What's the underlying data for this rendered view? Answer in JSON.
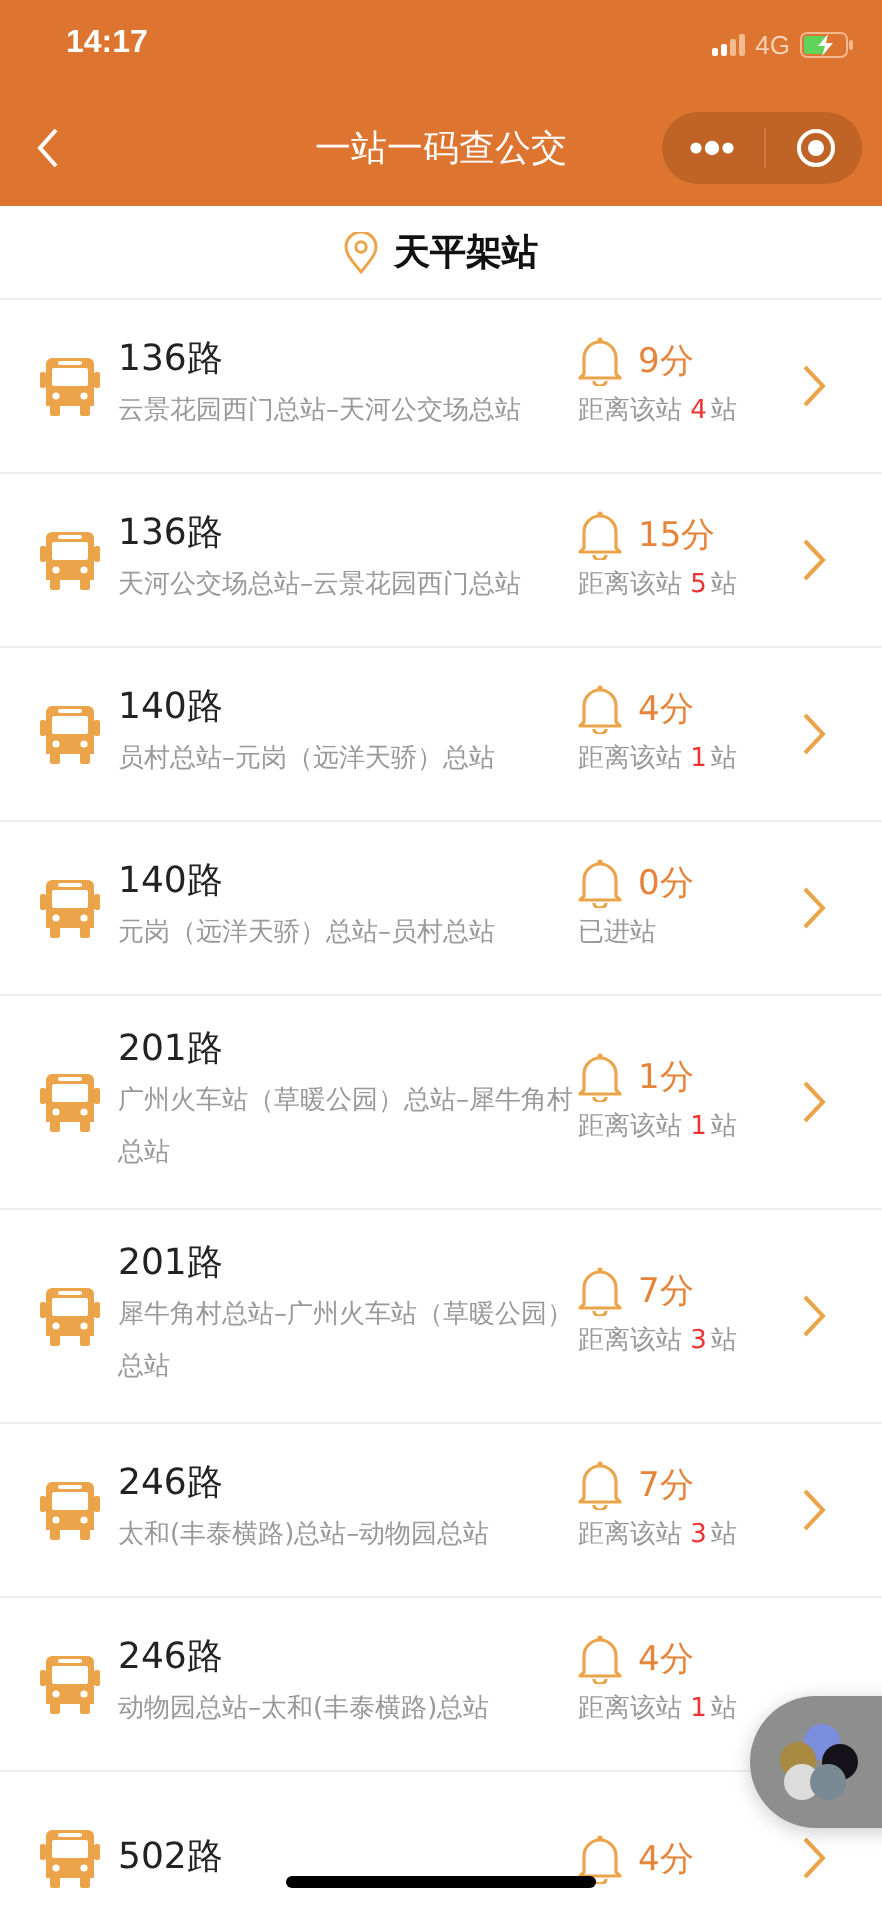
{
  "status_bar": {
    "time": "14:17",
    "network": "4G"
  },
  "nav": {
    "title": "一站一码查公交"
  },
  "station": {
    "name": "天平架站"
  },
  "routes": [
    {
      "name": "136路",
      "direction": "云景花园西门总站–天河公交场总站",
      "eta": "9分",
      "status": {
        "kind": "distance",
        "prefix": "距离该站",
        "count": "4",
        "suffix": "站"
      },
      "chevron": true
    },
    {
      "name": "136路",
      "direction": "天河公交场总站–云景花园西门总站",
      "eta": "15分",
      "status": {
        "kind": "distance",
        "prefix": "距离该站",
        "count": "5",
        "suffix": "站"
      },
      "chevron": true
    },
    {
      "name": "140路",
      "direction": "员村总站–元岗（远洋天骄）总站",
      "eta": "4分",
      "status": {
        "kind": "distance",
        "prefix": "距离该站",
        "count": "1",
        "suffix": "站"
      },
      "chevron": true
    },
    {
      "name": "140路",
      "direction": "元岗（远洋天骄）总站–员村总站",
      "eta": "0分",
      "status": {
        "kind": "arrived",
        "text": "已进站"
      },
      "chevron": true
    },
    {
      "name": "201路",
      "direction": "广州火车站（草暖公园）总站–犀牛角村总站",
      "eta": "1分",
      "status": {
        "kind": "distance",
        "prefix": "距离该站",
        "count": "1",
        "suffix": "站"
      },
      "chevron": true
    },
    {
      "name": "201路",
      "direction": "犀牛角村总站–广州火车站（草暖公园）总站",
      "eta": "7分",
      "status": {
        "kind": "distance",
        "prefix": "距离该站",
        "count": "3",
        "suffix": "站"
      },
      "chevron": true
    },
    {
      "name": "246路",
      "direction": "太和(丰泰横路)总站–动物园总站",
      "eta": "7分",
      "status": {
        "kind": "distance",
        "prefix": "距离该站",
        "count": "3",
        "suffix": "站"
      },
      "chevron": true
    },
    {
      "name": "246路",
      "direction": "动物园总站–太和(丰泰横路)总站",
      "eta": "4分",
      "status": {
        "kind": "distance",
        "prefix": "距离该站",
        "count": "1",
        "suffix": "站"
      },
      "chevron": false
    },
    {
      "name": "502路",
      "eta": "4分",
      "chevron": true
    }
  ]
}
